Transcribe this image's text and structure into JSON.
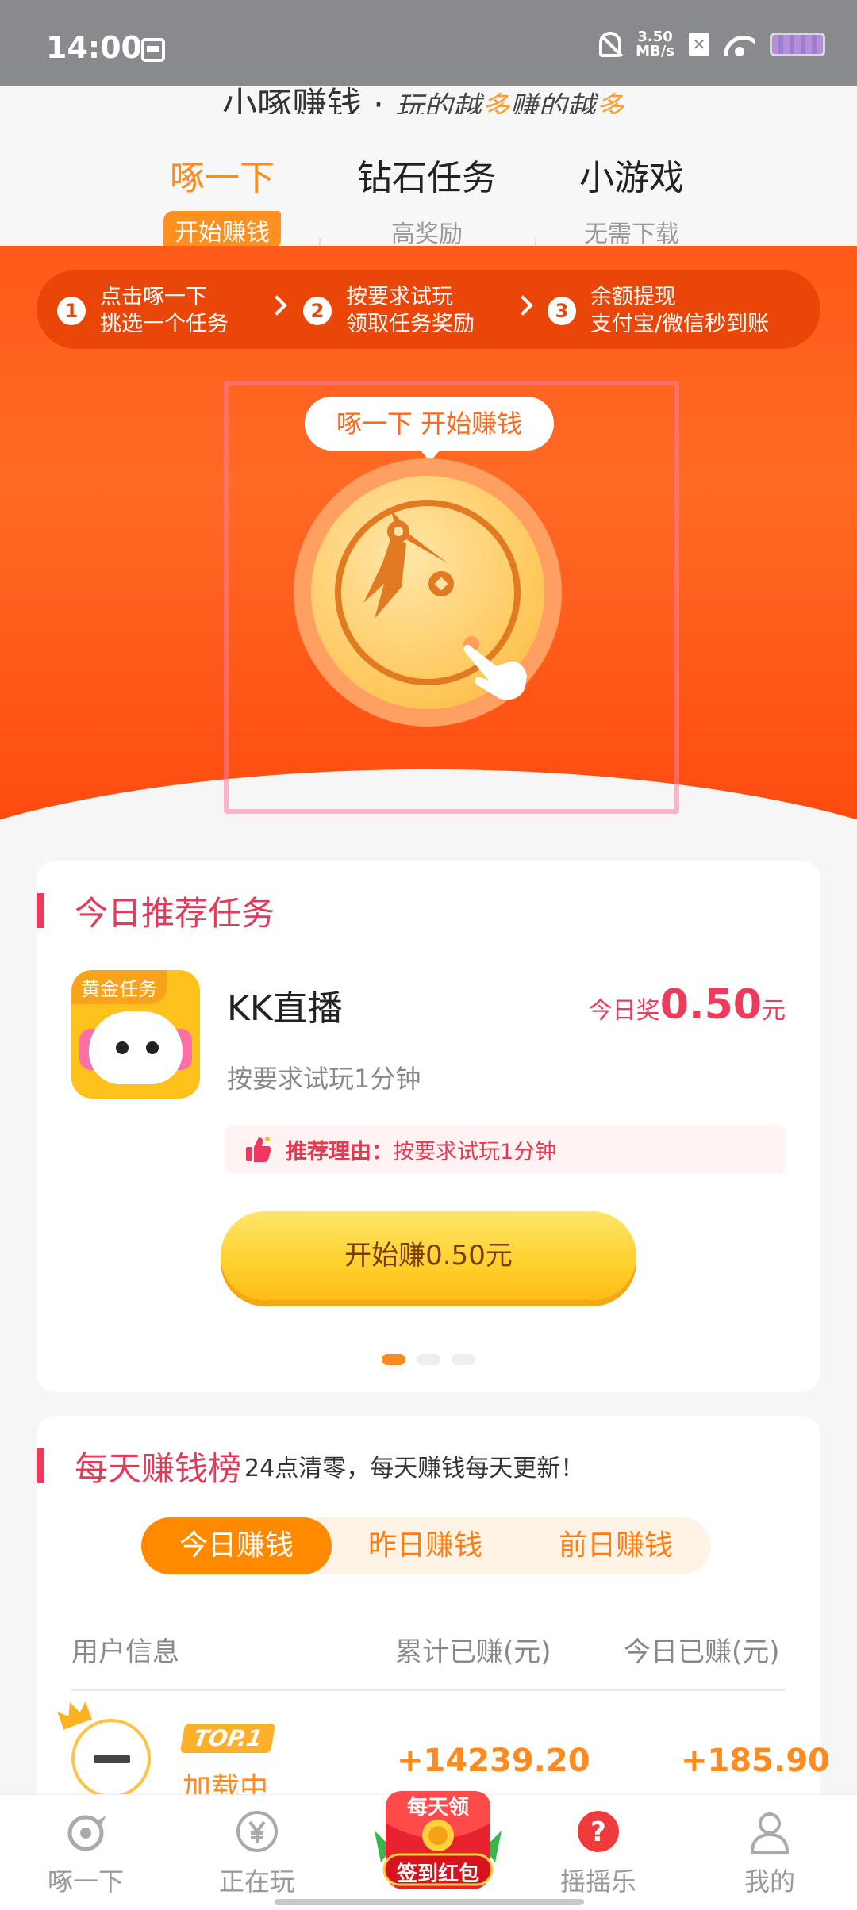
{
  "status_bar": {
    "time": "14:00",
    "speed": "3.50",
    "speed_unit": "MB/s"
  },
  "header": {
    "app_title": "小啄赚钱",
    "slogan_pre": "玩的越",
    "slogan_hl1": "多",
    "slogan_mid": "赚的越",
    "slogan_hl2": "多",
    "tabs": [
      {
        "label": "啄一下",
        "sub": "开始赚钱"
      },
      {
        "label": "钻石任务",
        "sub": "高奖励"
      },
      {
        "label": "小游戏",
        "sub": "无需下载"
      }
    ]
  },
  "steps": [
    {
      "num": "1",
      "line1": "点击啄一下",
      "line2": "挑选一个任务"
    },
    {
      "num": "2",
      "line1": "按要求试玩",
      "line2": "领取任务奖励"
    },
    {
      "num": "3",
      "line1": "余额提现",
      "line2": "支付宝/微信秒到账"
    }
  ],
  "hero": {
    "bubble": "啄一下 开始赚钱"
  },
  "recommend": {
    "title": "今日推荐任务",
    "badge": "黄金任务",
    "app_name": "KK直播",
    "desc": "按要求试玩1分钟",
    "reward_prefix": "今日奖",
    "reward_amount": "0.50",
    "reward_unit": "元",
    "reason_label": "推荐理由：",
    "reason_text": "按要求试玩1分钟",
    "button": "开始赚0.50元"
  },
  "ranking": {
    "title": "每天赚钱榜",
    "subtitle": "24点清零，每天赚钱每天更新！",
    "segments": [
      "今日赚钱",
      "昨日赚钱",
      "前日赚钱"
    ],
    "columns": [
      "用户信息",
      "累计已赚(元)",
      "今日已赚(元)"
    ],
    "rows": [
      {
        "badge": "TOP.1",
        "name": "加载中",
        "total": "+14239.20",
        "today": "+185.90"
      }
    ]
  },
  "bottom_nav": {
    "items": [
      "啄一下",
      "正在玩",
      "摇摇乐",
      "我的"
    ],
    "center_top": "每天领",
    "center_bottom": "签到红包"
  },
  "colors": {
    "accent": "#ff8a1e",
    "hero": "#ff5a1a",
    "title_red": "#e23b5a"
  }
}
